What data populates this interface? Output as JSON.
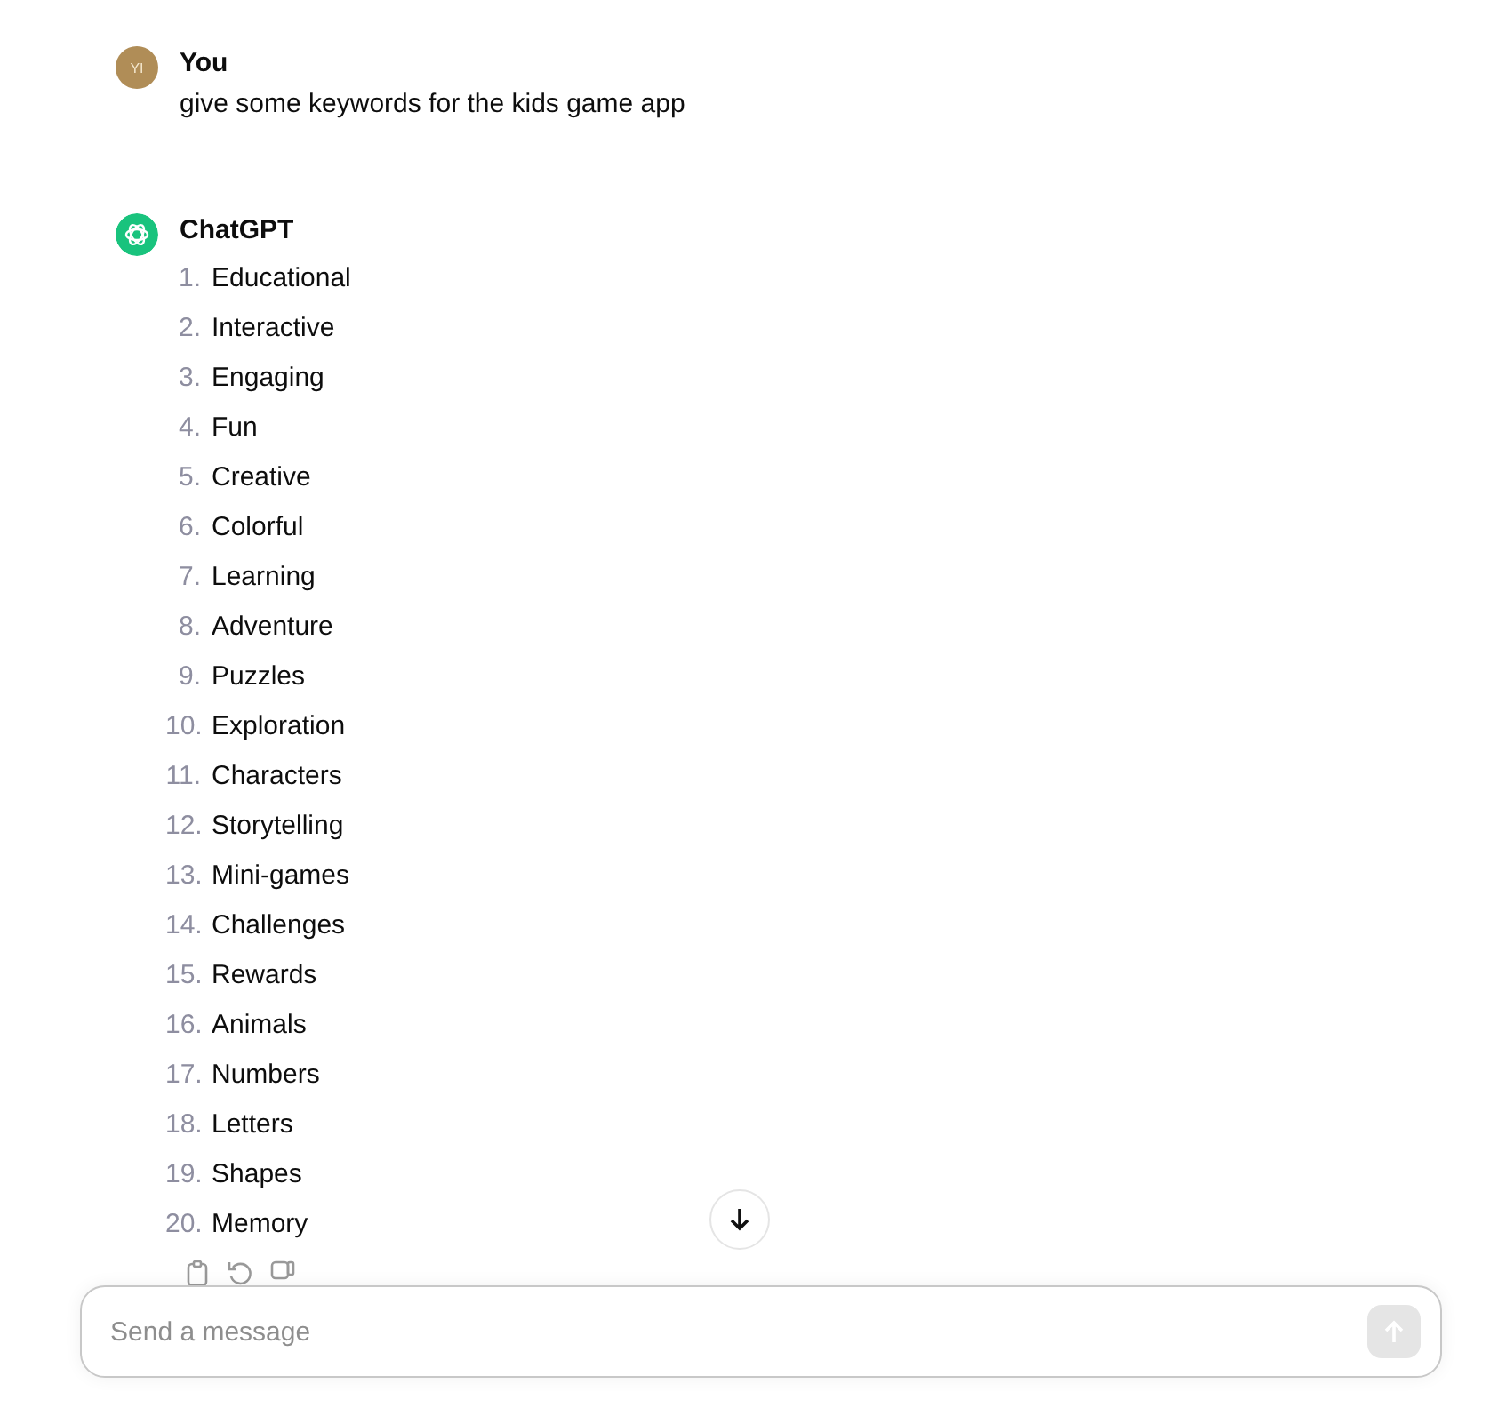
{
  "user_message": {
    "avatar": "YI",
    "author": "You",
    "text": "give some keywords for the kids game app"
  },
  "assistant_message": {
    "author": "ChatGPT",
    "items": [
      {
        "number": "1.",
        "text": "Educational"
      },
      {
        "number": "2.",
        "text": "Interactive"
      },
      {
        "number": "3.",
        "text": "Engaging"
      },
      {
        "number": "4.",
        "text": "Fun"
      },
      {
        "number": "5.",
        "text": "Creative"
      },
      {
        "number": "6.",
        "text": "Colorful"
      },
      {
        "number": "7.",
        "text": "Learning"
      },
      {
        "number": "8.",
        "text": "Adventure"
      },
      {
        "number": "9.",
        "text": "Puzzles"
      },
      {
        "number": "10.",
        "text": "Exploration"
      },
      {
        "number": "11.",
        "text": "Characters"
      },
      {
        "number": "12.",
        "text": "Storytelling"
      },
      {
        "number": "13.",
        "text": "Mini-games"
      },
      {
        "number": "14.",
        "text": "Challenges"
      },
      {
        "number": "15.",
        "text": "Rewards"
      },
      {
        "number": "16.",
        "text": "Animals"
      },
      {
        "number": "17.",
        "text": "Numbers"
      },
      {
        "number": "18.",
        "text": "Letters"
      },
      {
        "number": "19.",
        "text": "Shapes"
      },
      {
        "number": "20.",
        "text": "Memory"
      }
    ]
  },
  "composer": {
    "placeholder": "Send a message"
  }
}
